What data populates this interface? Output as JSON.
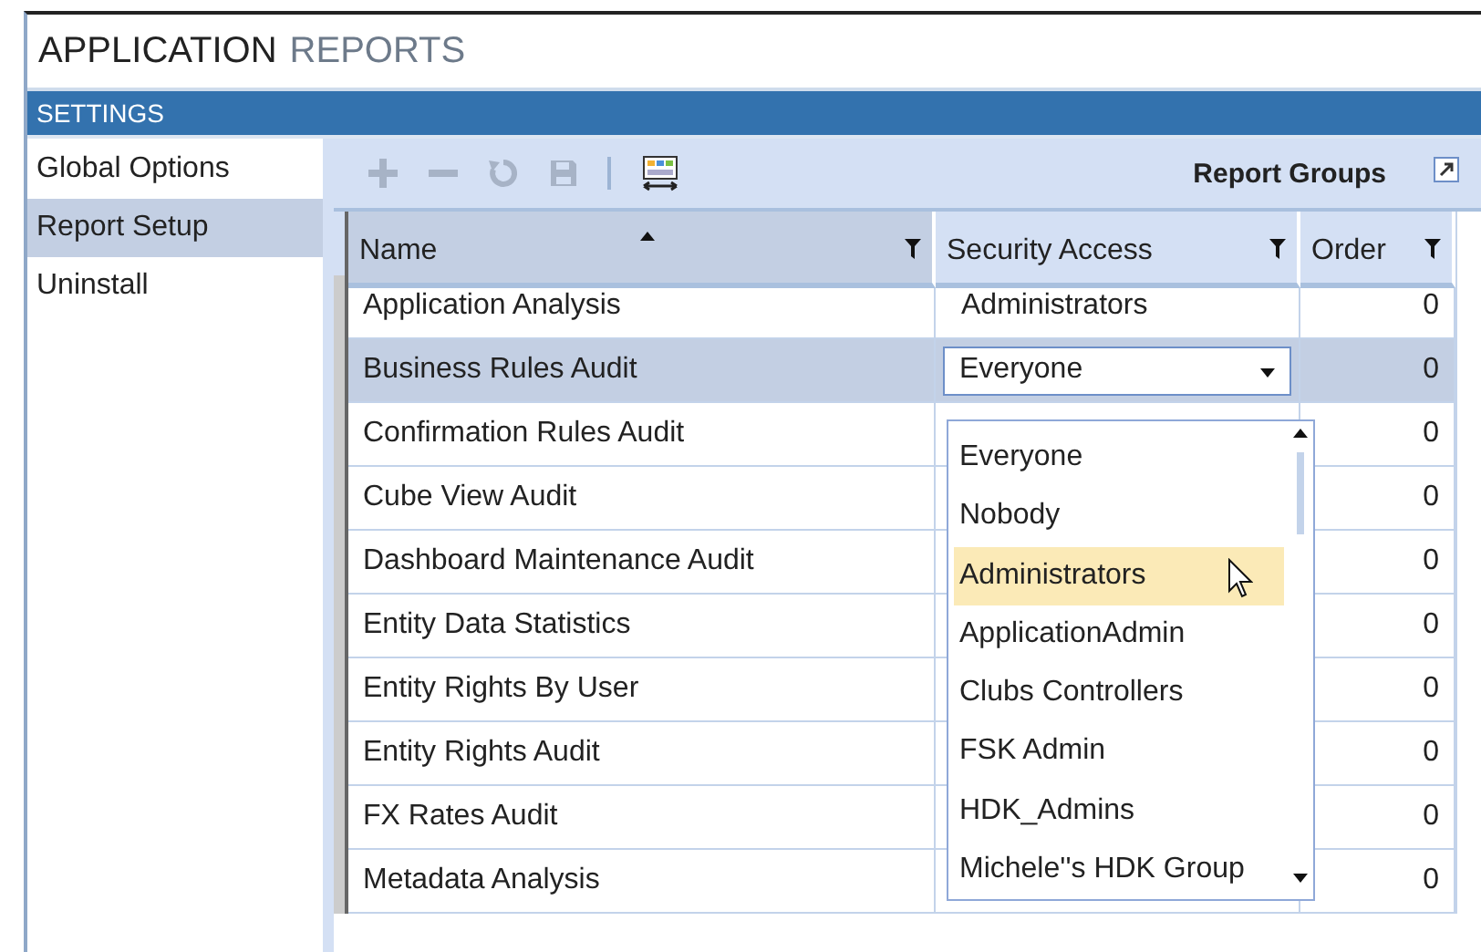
{
  "window": {
    "title_primary": "APPLICATION",
    "title_secondary": "REPORTS"
  },
  "section_bar": {
    "label": "SETTINGS"
  },
  "sidebar": {
    "items": [
      {
        "label": "Global Options",
        "selected": false
      },
      {
        "label": "Report Setup",
        "selected": true
      },
      {
        "label": "Uninstall",
        "selected": false
      }
    ]
  },
  "toolbar": {
    "buttons": [
      {
        "kind": "add",
        "disabled": true
      },
      {
        "kind": "remove",
        "disabled": true
      },
      {
        "kind": "refresh",
        "disabled": true
      },
      {
        "kind": "save",
        "disabled": true
      },
      {
        "kind": "separator"
      },
      {
        "kind": "columns",
        "disabled": false
      }
    ],
    "title": "Report Groups"
  },
  "table": {
    "columns": [
      {
        "label": "Name",
        "sorted": true
      },
      {
        "label": "Security Access",
        "sorted": false
      },
      {
        "label": "Order",
        "sorted": false
      }
    ],
    "rows": [
      {
        "name": "Application Analysis",
        "security": "Administrators",
        "order": "0",
        "selected": false
      },
      {
        "name": "Business Rules Audit",
        "security": "Everyone",
        "order": "0",
        "selected": true
      },
      {
        "name": "Confirmation Rules Audit",
        "order": "0",
        "selected": false
      },
      {
        "name": "Cube View Audit",
        "order": "0",
        "selected": false
      },
      {
        "name": "Dashboard Maintenance Audit",
        "order": "0",
        "selected": false
      },
      {
        "name": "Entity Data Statistics",
        "order": "0",
        "selected": false
      },
      {
        "name": "Entity Rights By User",
        "order": "0",
        "selected": false
      },
      {
        "name": "Entity Rights Audit",
        "order": "0",
        "selected": false
      },
      {
        "name": "FX Rates Audit",
        "order": "0",
        "selected": false
      },
      {
        "name": "Metadata Analysis",
        "order": "0",
        "selected": false
      }
    ]
  },
  "dropdown": {
    "items": [
      {
        "label": "Everyone",
        "selected": false
      },
      {
        "label": "Nobody",
        "selected": false
      },
      {
        "label": "Administrators",
        "selected": true
      },
      {
        "label": "ApplicationAdmin",
        "selected": false
      },
      {
        "label": "Clubs Controllers",
        "selected": false
      },
      {
        "label": "FSK Admin",
        "selected": false
      },
      {
        "label": "HDK_Admins",
        "selected": false
      },
      {
        "label": "Michele''s HDK Group",
        "selected": false
      }
    ]
  }
}
